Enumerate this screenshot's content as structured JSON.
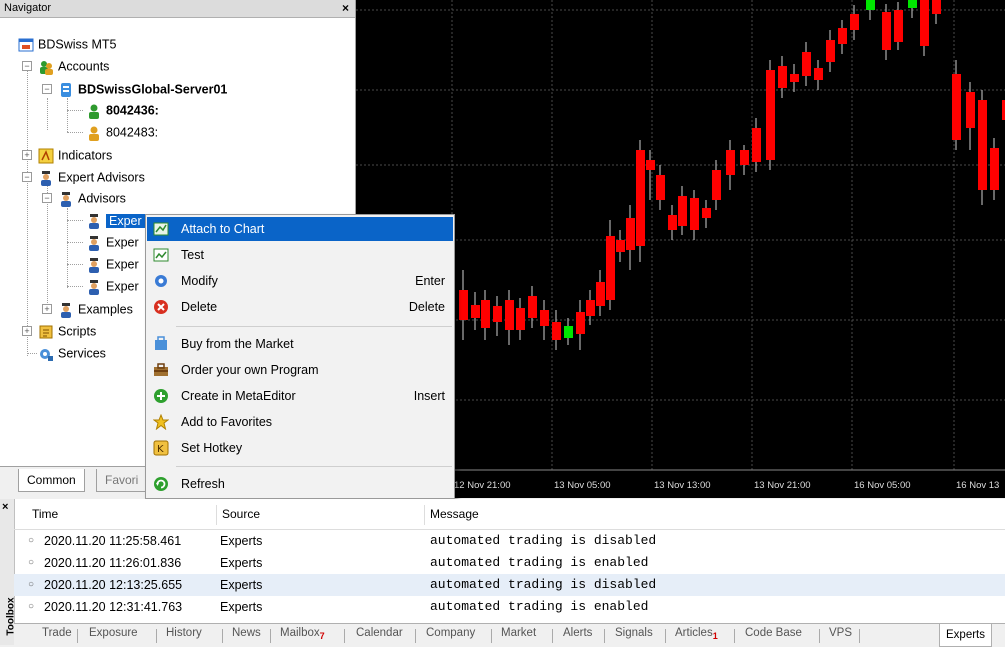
{
  "navigator": {
    "title": "Navigator",
    "close": "×",
    "root": "BDSwiss MT5",
    "accounts": "Accounts",
    "server": "BDSwissGlobal-Server01",
    "account1": "8042436:",
    "account2": "8042483:",
    "indicators": "Indicators",
    "expert_advisors": "Expert Advisors",
    "advisors": "Advisors",
    "expert_items": [
      "Exper",
      "Exper",
      "Exper",
      "Exper"
    ],
    "examples": "Examples",
    "scripts": "Scripts",
    "services": "Services",
    "tabs": [
      "Common",
      "Favori"
    ]
  },
  "chart": {
    "time_labels": [
      "12 Nov 21:00",
      "13 Nov 05:00",
      "13 Nov 13:00",
      "13 Nov 21:00",
      "16 Nov 05:00",
      "16 Nov 13"
    ],
    "colors": {
      "bull": "#00e600",
      "bear": "#ff0000",
      "wick": "#d0d0d0",
      "grid": "#4a4a4a"
    }
  },
  "context_menu": {
    "items": [
      {
        "label": "Attach to Chart",
        "shortcut": "",
        "icon": "attach-chart-icon"
      },
      {
        "label": "Test",
        "shortcut": "",
        "icon": "test-icon"
      },
      {
        "label": "Modify",
        "shortcut": "Enter",
        "icon": "modify-icon"
      },
      {
        "label": "Delete",
        "shortcut": "Delete",
        "icon": "delete-icon"
      },
      {
        "label": "Buy from the Market",
        "shortcut": "",
        "icon": "market-icon"
      },
      {
        "label": "Order your own Program",
        "shortcut": "",
        "icon": "order-icon"
      },
      {
        "label": "Create in MetaEditor",
        "shortcut": "Insert",
        "icon": "create-icon"
      },
      {
        "label": "Add to Favorites",
        "shortcut": "",
        "icon": "favorites-icon"
      },
      {
        "label": "Set Hotkey",
        "shortcut": "",
        "icon": "hotkey-icon"
      },
      {
        "label": "Refresh",
        "shortcut": "",
        "icon": "refresh-icon"
      }
    ]
  },
  "toolbox": {
    "side_label": "Toolbox",
    "close": "×",
    "headers": {
      "time": "Time",
      "source": "Source",
      "message": "Message"
    },
    "rows": [
      {
        "time": "2020.11.20 11:25:58.461",
        "source": "Experts",
        "message": "automated trading is disabled"
      },
      {
        "time": "2020.11.20 11:26:01.836",
        "source": "Experts",
        "message": "automated trading is enabled"
      },
      {
        "time": "2020.11.20 12:13:25.655",
        "source": "Experts",
        "message": "automated trading is disabled"
      },
      {
        "time": "2020.11.20 12:31:41.763",
        "source": "Experts",
        "message": "automated trading is enabled"
      }
    ],
    "tabs": [
      "Trade",
      "Exposure",
      "History",
      "News",
      "Mailbox",
      "Calendar",
      "Company",
      "Market",
      "Alerts",
      "Signals",
      "Articles",
      "Code Base",
      "VPS",
      "Experts"
    ],
    "mailbox_badge": "7",
    "articles_badge": "1"
  }
}
